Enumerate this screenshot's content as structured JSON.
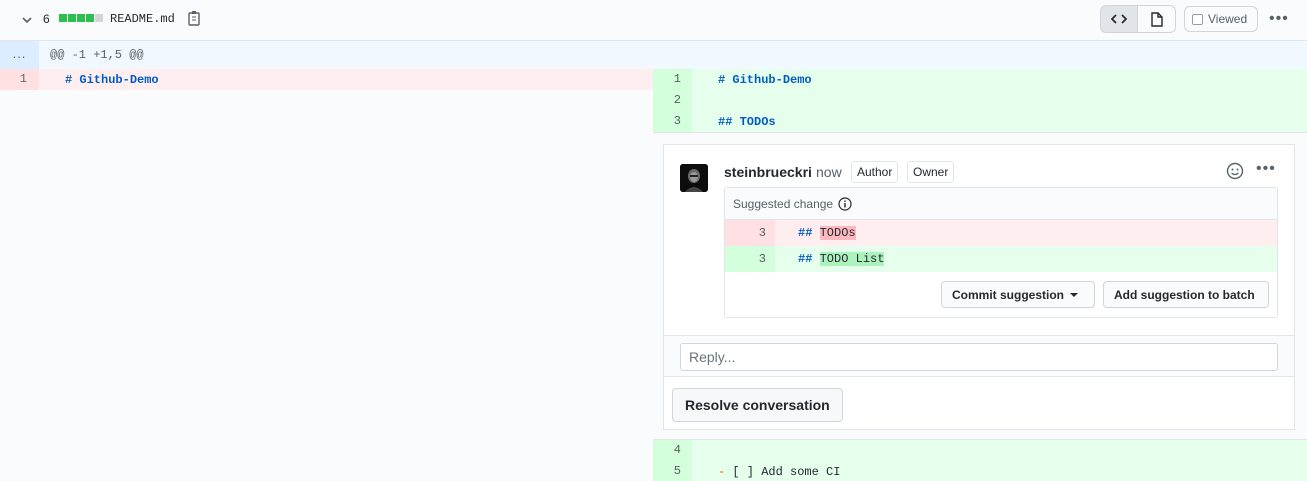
{
  "file": {
    "additions": "6",
    "diffstat": [
      "#2cbe4e",
      "#2cbe4e",
      "#2cbe4e",
      "#2cbe4e",
      "#d1d5da"
    ],
    "name": "README.md",
    "viewed_label": "Viewed"
  },
  "hunk": {
    "expand_label": "...",
    "header": "@@ -1 +1,5 @@"
  },
  "left_lines": [
    {
      "num": "1",
      "hash": "#",
      "text": "Github-Demo"
    }
  ],
  "right_lines_top": [
    {
      "num": "1",
      "hash": "#",
      "text": "Github-Demo"
    },
    {
      "num": "2",
      "hash": "",
      "text": ""
    },
    {
      "num": "3",
      "hash": "##",
      "text": "TODOs"
    }
  ],
  "right_lines_bottom": [
    {
      "num": "4",
      "text": ""
    },
    {
      "num": "5",
      "dash": "-",
      "text": "[ ] Add some CI"
    }
  ],
  "comment": {
    "author": "steinbrueckri",
    "time": "now",
    "badges": [
      "Author",
      "Owner"
    ],
    "suggested_change_label": "Suggested change",
    "suggestion": {
      "removed": {
        "num": "3",
        "hash": "##",
        "text": "TODOs"
      },
      "added": {
        "num": "3",
        "hash": "##",
        "text": "TODO List"
      }
    },
    "commit_button": "Commit suggestion",
    "batch_button": "Add suggestion to batch",
    "reply_placeholder": "Reply...",
    "resolve_button": "Resolve conversation"
  },
  "colors": {
    "deletion_bg": "#ffeef0",
    "addition_bg": "#e6ffed",
    "heading": "#005cc5"
  }
}
